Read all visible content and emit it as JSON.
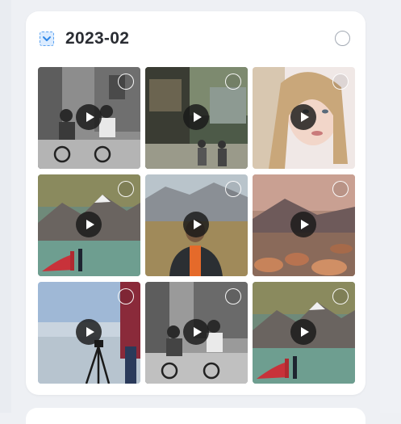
{
  "group": {
    "title": "2023-02",
    "checkbox_icon": "chevron-down-icon",
    "checkbox_state": "partial",
    "accent": "#5aa2f1"
  },
  "tiles": [
    {
      "name": "children-tricycles-bw",
      "type": "video",
      "selected": false
    },
    {
      "name": "old-street-cyclists",
      "type": "video",
      "selected": false
    },
    {
      "name": "woman-portrait",
      "type": "video",
      "selected": false
    },
    {
      "name": "mountain-couple-red-dress",
      "type": "video",
      "selected": false
    },
    {
      "name": "man-orange-jacket",
      "type": "video",
      "selected": false
    },
    {
      "name": "rocky-shore-sunset",
      "type": "video",
      "selected": false
    },
    {
      "name": "beach-photographer-tripod",
      "type": "video",
      "selected": false
    },
    {
      "name": "children-tricycles-bw-2",
      "type": "video",
      "selected": false
    },
    {
      "name": "mountain-couple-red-dress-2",
      "type": "video",
      "selected": false
    }
  ]
}
